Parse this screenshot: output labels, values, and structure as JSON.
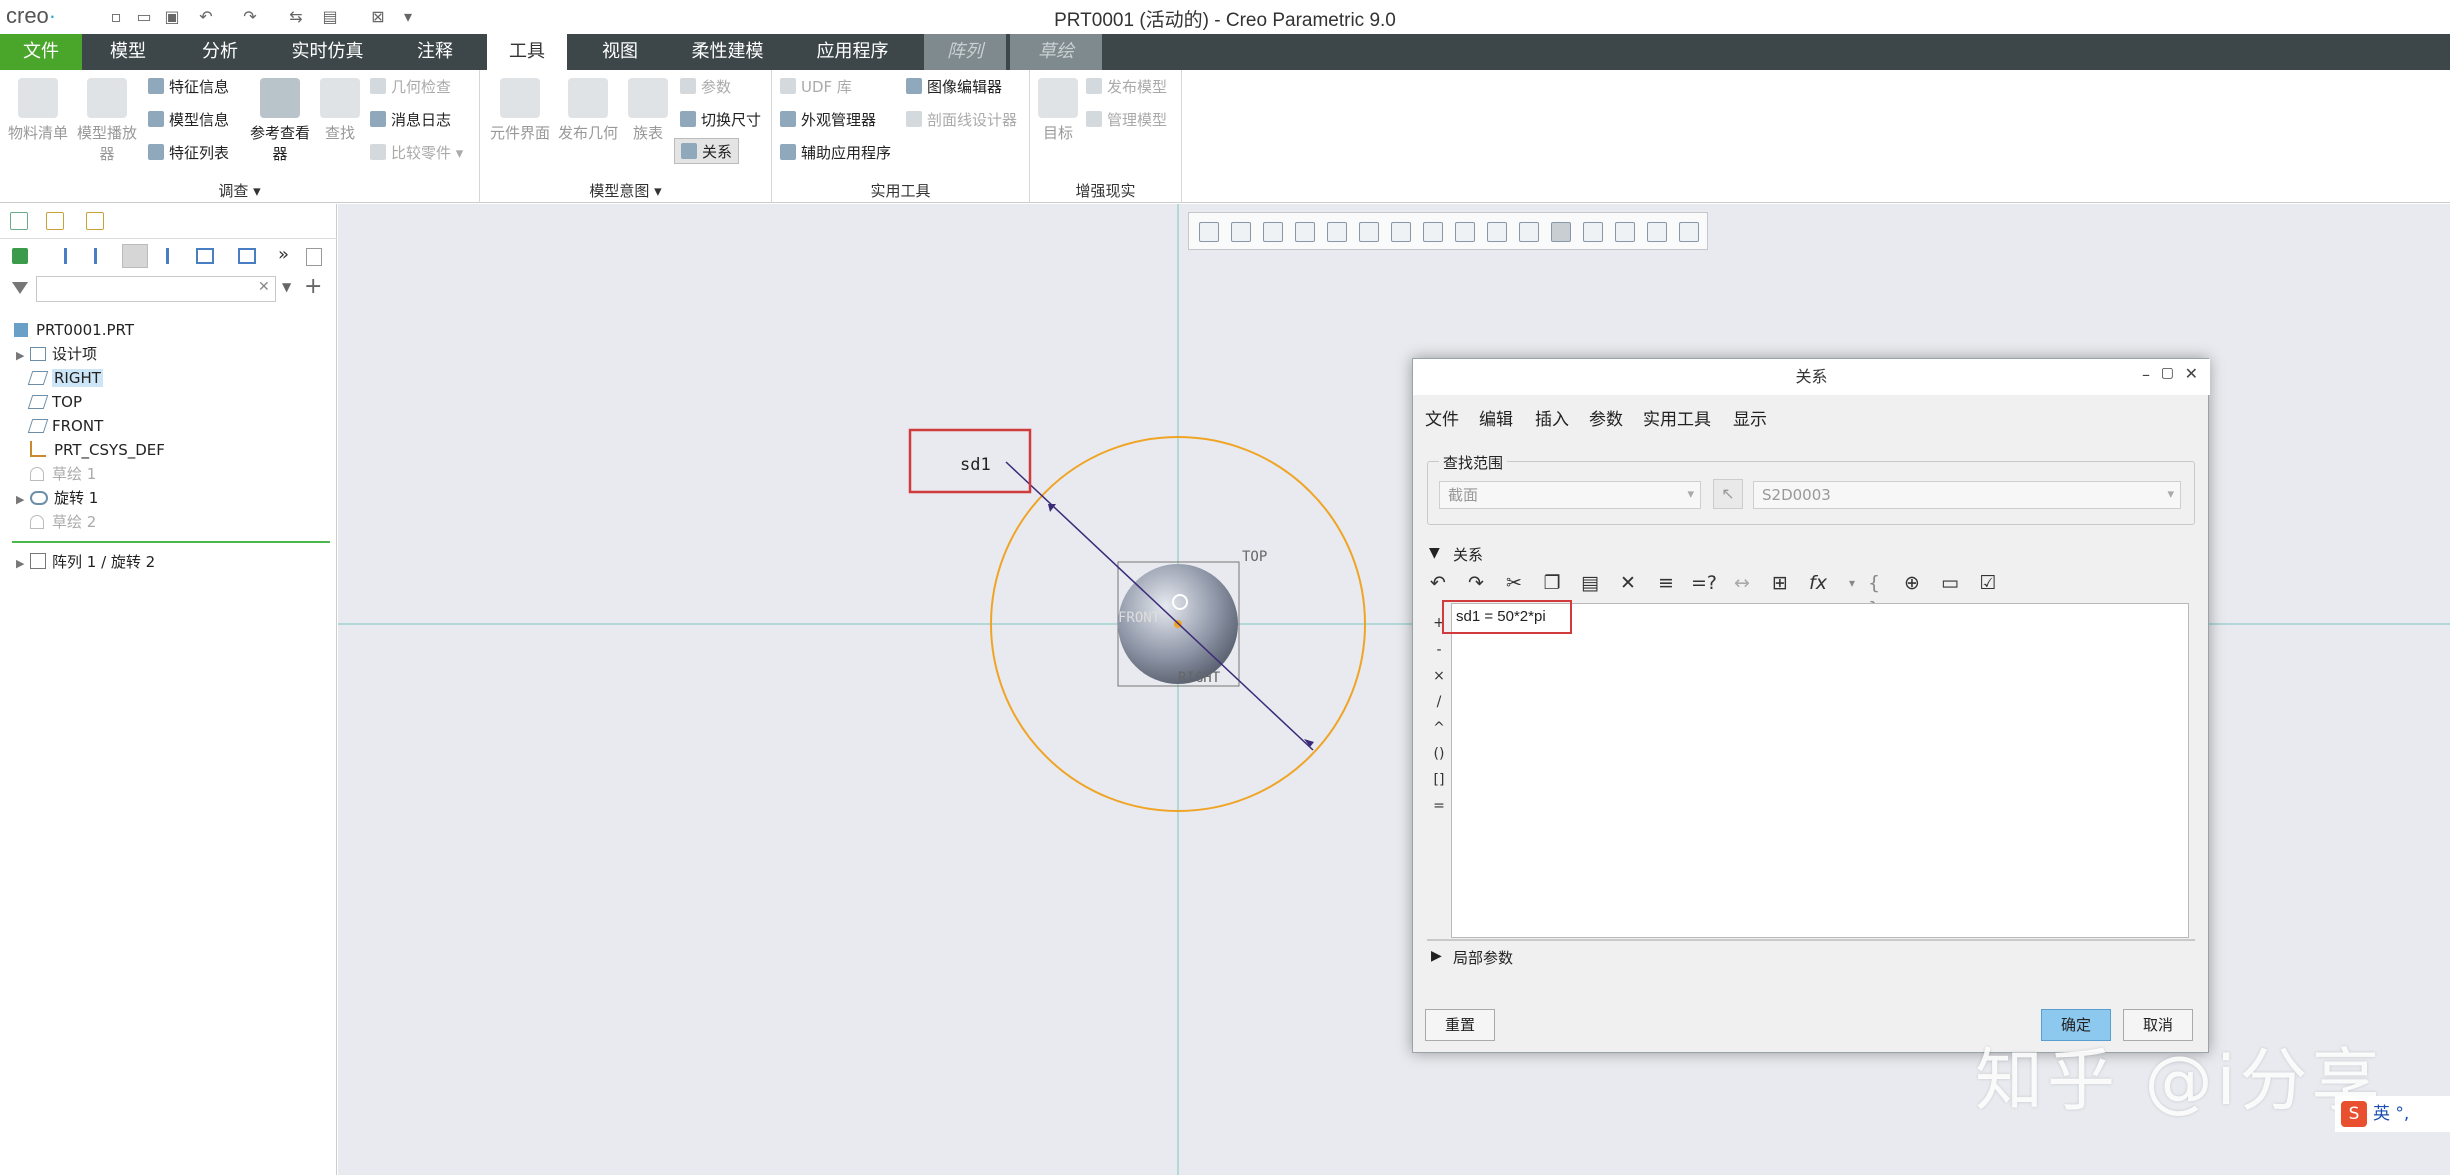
{
  "app": {
    "logo": "creo",
    "logo_mark": "·",
    "window_title": "PRT0001 (活动的) - Creo Parametric 9.0"
  },
  "menu": {
    "tabs": [
      "文件",
      "模型",
      "分析",
      "实时仿真",
      "注释",
      "工具",
      "视图",
      "柔性建模",
      "应用程序",
      "阵列",
      "草绘"
    ],
    "active": "工具"
  },
  "ribbon": {
    "investigate": {
      "label": "调查 ▾",
      "bom": "物料清单",
      "model_player": "模型播放器",
      "feature_info": "特征信息",
      "model_info": "模型信息",
      "feature_list": "特征列表",
      "ref_viewer": "参考查看器",
      "find": "查找",
      "geom_check": "几何检查",
      "message_log": "消息日志",
      "compare_part": "比较零件 ▾"
    },
    "model_intent": {
      "label": "模型意图 ▾",
      "component_interface": "元件界面",
      "publish_geom": "发布几何",
      "family_table": "族表",
      "params": "参数",
      "switch_dim": "切换尺寸",
      "relations": "关系"
    },
    "utilities": {
      "label": "实用工具",
      "udf_lib": "UDF 库",
      "appearance_mgr": "外观管理器",
      "aux_apps": "辅助应用程序",
      "image_editor": "图像编辑器",
      "section_designer": "剖面线设计器"
    },
    "ar": {
      "label": "增强现实",
      "target": "目标",
      "publish_model": "发布模型",
      "manage_model": "管理模型"
    }
  },
  "tree": {
    "search_placeholder": "",
    "root": "PRT0001.PRT",
    "items": [
      {
        "label": "设计项",
        "dim": false,
        "exp": "▶"
      },
      {
        "label": "RIGHT",
        "dim": false,
        "exp": ""
      },
      {
        "label": "TOP",
        "dim": false,
        "exp": ""
      },
      {
        "label": "FRONT",
        "dim": false,
        "exp": ""
      },
      {
        "label": "PRT_CSYS_DEF",
        "dim": false,
        "exp": ""
      },
      {
        "label": "草绘 1",
        "dim": true,
        "exp": ""
      },
      {
        "label": "旋转 1",
        "dim": false,
        "exp": "▶"
      },
      {
        "label": "草绘 2",
        "dim": true,
        "exp": ""
      }
    ],
    "pattern_item": "阵列 1 / 旋转 2"
  },
  "viewport": {
    "dim_label": "sd1",
    "top_label": "TOP",
    "front_label": "FRONT",
    "right_label": "RIGHT"
  },
  "dialog": {
    "title": "关系",
    "menus": [
      "文件",
      "编辑",
      "插入",
      "参数",
      "实用工具",
      "显示"
    ],
    "lookup_label": "查找范围",
    "lookup_type": "截面",
    "lookup_name": "S2D0003",
    "relations_label": "关系",
    "relation_text": "sd1 = 50*2*pi",
    "ops": [
      "+",
      "-",
      "×",
      "/",
      "^",
      "()",
      "[]",
      "="
    ],
    "local_params": "局部参数",
    "reset": "重置",
    "ok": "确定",
    "cancel": "取消"
  },
  "watermark": "知乎 @i分享",
  "ime": "英 °,"
}
